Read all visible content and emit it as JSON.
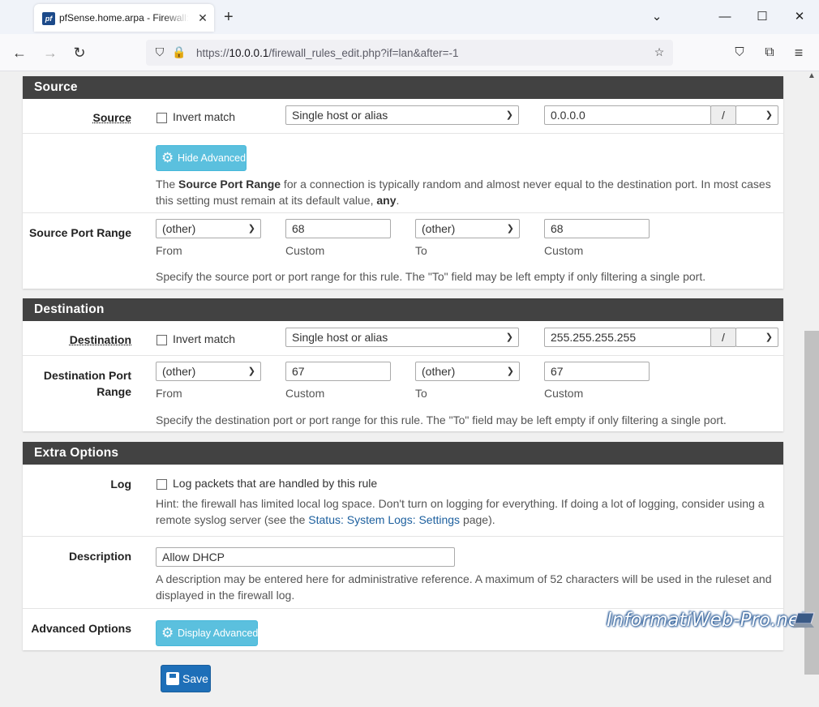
{
  "browser": {
    "tab_title": "pfSense.home.arpa - Firewall: R",
    "favicon": "pf",
    "url_prefix": "https://",
    "url_host": "10.0.0.1",
    "url_path": "/firewall_rules_edit.php?if=lan&after=-1"
  },
  "source": {
    "header": "Source",
    "label": "Source",
    "invert_label": "Invert match",
    "type_select": "Single host or alias",
    "address": "0.0.0.0",
    "slash": "/",
    "hide_advanced": "Hide Advanced",
    "help_pre": "The ",
    "help_bold": "Source Port Range",
    "help_post": " for a connection is typically random and almost never equal to the destination port. In most cases this setting must remain at its default value, ",
    "help_any": "any",
    "help_end": ".",
    "port_label": "Source Port Range",
    "from_select": "(other)",
    "from_custom": "68",
    "to_select": "(other)",
    "to_custom": "68",
    "from_label": "From",
    "custom_label": "Custom",
    "to_label": "To",
    "custom_label2": "Custom",
    "port_help": "Specify the source port or port range for this rule. The \"To\" field may be left empty if only filtering a single port."
  },
  "destination": {
    "header": "Destination",
    "label": "Destination",
    "invert_label": "Invert match",
    "type_select": "Single host or alias",
    "address": "255.255.255.255",
    "slash": "/",
    "port_label_1": "Destination Port",
    "port_label_2": "Range",
    "from_select": "(other)",
    "from_custom": "67",
    "to_select": "(other)",
    "to_custom": "67",
    "from_label": "From",
    "custom_label": "Custom",
    "to_label": "To",
    "custom_label2": "Custom",
    "port_help": "Specify the destination port or port range for this rule. The \"To\" field may be left empty if only filtering a single port."
  },
  "extra": {
    "header": "Extra Options",
    "log_label": "Log",
    "log_checkbox": "Log packets that are handled by this rule",
    "log_hint_1": "Hint: the firewall has limited local log space. Don't turn on logging for everything. If doing a lot of logging, consider using a remote syslog server (see the ",
    "log_hint_link": "Status: System Logs: Settings",
    "log_hint_2": " page).",
    "desc_label": "Description",
    "desc_value": "Allow DHCP",
    "desc_help": "A description may be entered here for administrative reference. A maximum of 52 characters will be used in the ruleset and displayed in the firewall log.",
    "adv_label": "Advanced Options",
    "display_advanced": "Display Advanced"
  },
  "save_label": "Save",
  "watermark": "InformatiWeb-Pro.net"
}
